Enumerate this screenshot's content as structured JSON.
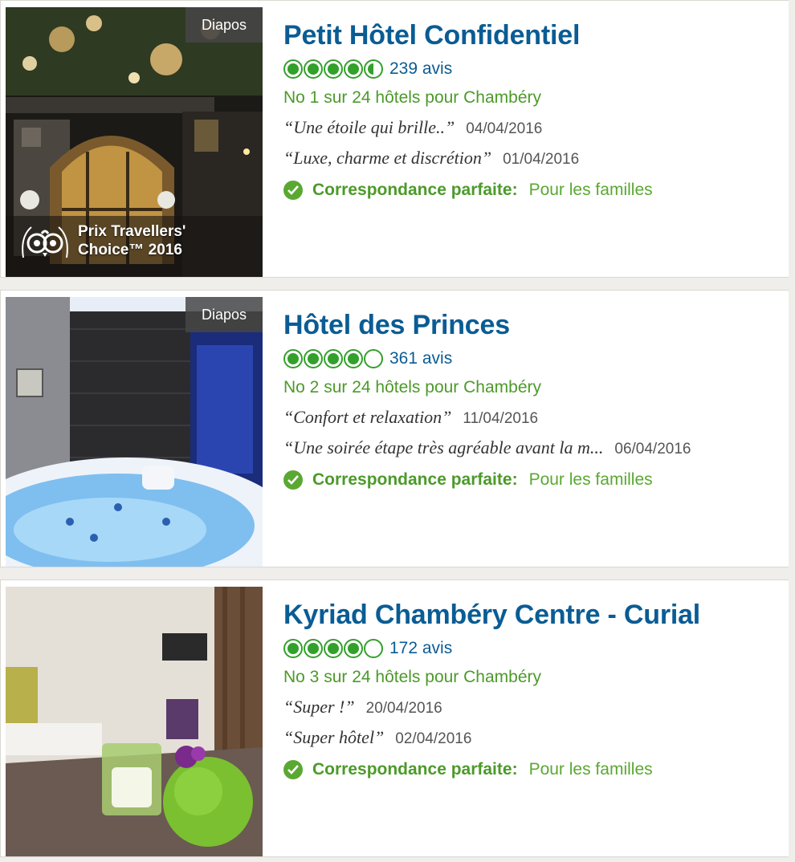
{
  "listings": [
    {
      "name": "Petit Hôtel Confidentiel",
      "rating": 4.5,
      "reviews": "239 avis",
      "rank": "No 1 sur 24 hôtels pour Chambéry",
      "diapos": "Diapos",
      "award_line1": "Prix Travellers'",
      "award_line2": "Choice™ 2016",
      "review1": {
        "quote": "“Une étoile qui brille..”",
        "date": "04/04/2016"
      },
      "review2": {
        "quote": "“Luxe, charme et discrétion”",
        "date": "01/04/2016"
      },
      "match_label": "Correspondance parfaite:",
      "match_value": "Pour les familles"
    },
    {
      "name": "Hôtel des Princes",
      "rating": 4,
      "reviews": "361 avis",
      "rank": "No 2 sur 24 hôtels pour Chambéry",
      "diapos": "Diapos",
      "review1": {
        "quote": "“Confort et relaxation”",
        "date": "11/04/2016"
      },
      "review2": {
        "quote": "“Une soirée étape très agréable avant la m...",
        "date": "06/04/2016"
      },
      "match_label": "Correspondance parfaite:",
      "match_value": "Pour les familles"
    },
    {
      "name": "Kyriad Chambéry Centre - Curial",
      "rating": 4,
      "reviews": "172 avis",
      "rank": "No 3 sur 24 hôtels pour Chambéry",
      "review1": {
        "quote": "“Super !”",
        "date": "20/04/2016"
      },
      "review2": {
        "quote": "“Super hôtel”",
        "date": "02/04/2016"
      },
      "match_label": "Correspondance parfaite:",
      "match_value": "Pour les familles"
    }
  ],
  "colors": {
    "title": "#0a5c94",
    "green": "#4c9a2a",
    "bubble": "#33a02c"
  }
}
